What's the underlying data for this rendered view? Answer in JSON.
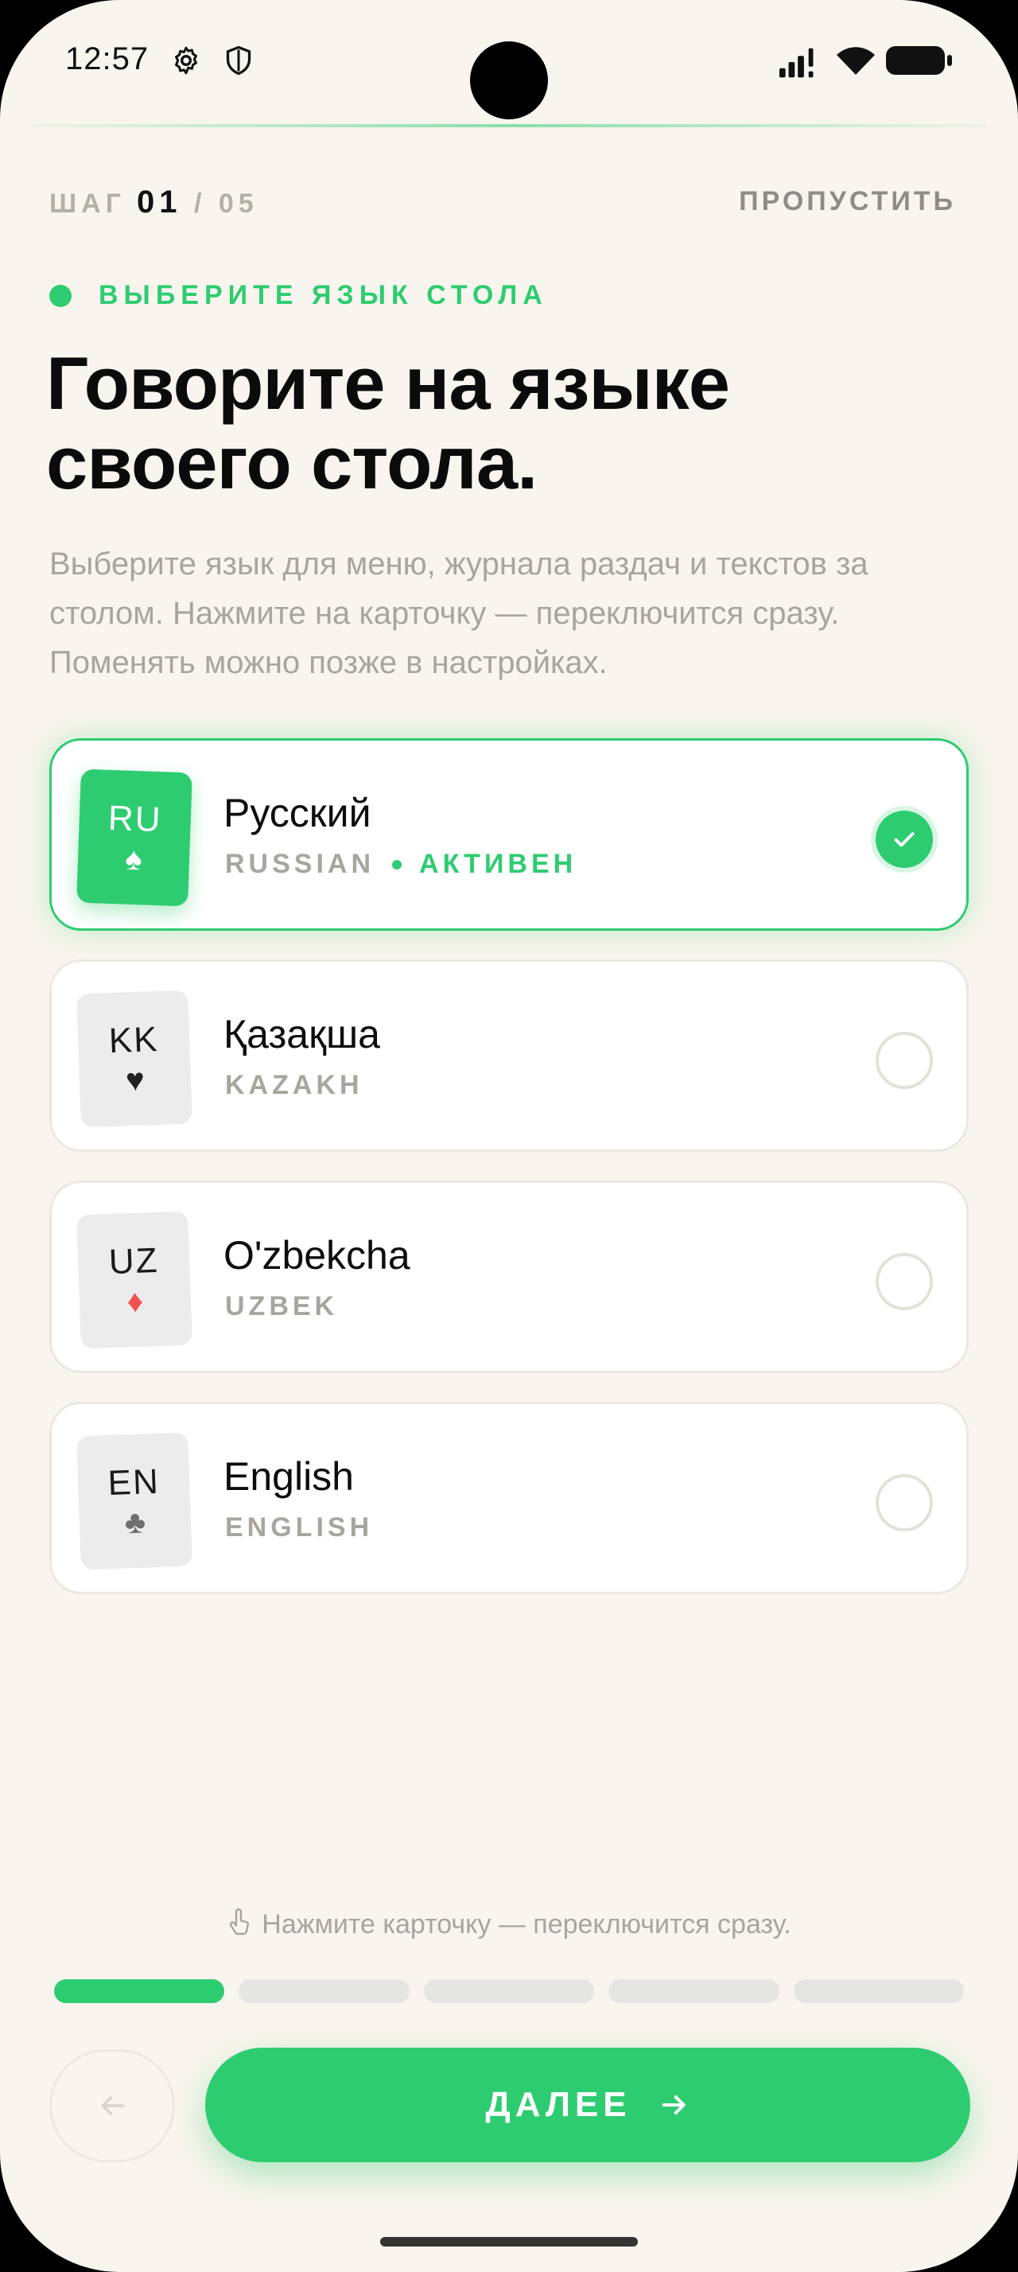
{
  "status_bar": {
    "time": "12:57",
    "icons": [
      "gear-icon",
      "shield-icon",
      "signal-icon",
      "wifi-icon",
      "battery-icon"
    ]
  },
  "header": {
    "step_label": "ШАГ",
    "step_current": "01",
    "step_separator": "/",
    "step_total": "05",
    "skip_label": "ПРОПУСТИТЬ"
  },
  "eyebrow": "ВЫБЕРИТЕ ЯЗЫК СТОЛА",
  "title": "Говорите на языке своего стола.",
  "subtitle": "Выберите язык для меню, журнала раздач и текстов за столом. Нажмите на карточку — переключится сразу. Поменять можно позже в настройках.",
  "languages": [
    {
      "code": "RU",
      "suit": "♠",
      "name": "Русский",
      "subtitle": "RUSSIAN",
      "status": "АКТИВЕН",
      "selected": true
    },
    {
      "code": "KK",
      "suit": "♥",
      "name": "Қазақша",
      "subtitle": "KAZAKH",
      "selected": false
    },
    {
      "code": "UZ",
      "suit": "♦",
      "name": "O'zbekcha",
      "subtitle": "UZBEK",
      "selected": false
    },
    {
      "code": "EN",
      "suit": "♣",
      "name": "English",
      "subtitle": "ENGLISH",
      "selected": false
    }
  ],
  "hint": "Нажмите карточку — переключится сразу.",
  "progress": {
    "current": 1,
    "total": 5
  },
  "footer": {
    "next_label": "ДАЛЕЕ"
  },
  "colors": {
    "accent": "#2ecc71",
    "background": "#f8f5ee",
    "muted_text": "#a8a59f",
    "red_suit": "#ef5350"
  }
}
